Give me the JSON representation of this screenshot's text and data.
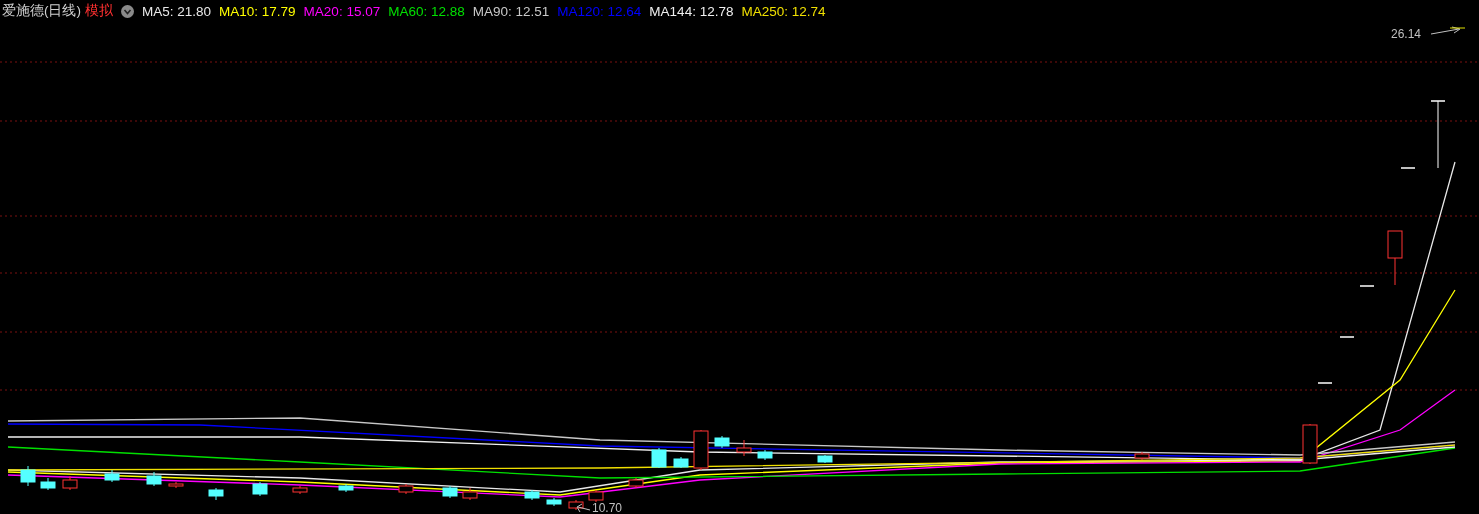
{
  "title": "爱施德(日线)",
  "mode_badge": "模拟",
  "indicators": [
    {
      "label": "MA5: 21.80",
      "color": "#e8e8e8"
    },
    {
      "label": "MA10: 17.79",
      "color": "#ffff00"
    },
    {
      "label": "MA20: 15.07",
      "color": "#ff00ff"
    },
    {
      "label": "MA60: 12.88",
      "color": "#00e000"
    },
    {
      "label": "MA90: 12.51",
      "color": "#c8c8c8"
    },
    {
      "label": "MA120: 12.64",
      "color": "#0000ff"
    },
    {
      "label": "MA144: 12.78",
      "color": "#f0f0f0"
    },
    {
      "label": "MA250: 12.74",
      "color": "#f0e000"
    }
  ],
  "chart": {
    "high_label": "26.14",
    "low_label": "10.70"
  }
}
